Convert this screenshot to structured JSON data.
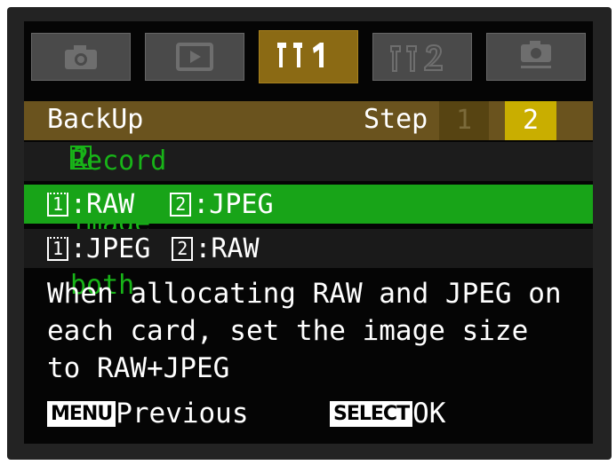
{
  "tabs": [
    {
      "label": "◉",
      "name": "shooting"
    },
    {
      "label": "▷",
      "name": "playback"
    },
    {
      "label": "ƒĂ1",
      "name": "setup-1"
    },
    {
      "label": "ƒĂ2",
      "name": "setup-2"
    },
    {
      "label": "▣",
      "name": "custom"
    }
  ],
  "header": {
    "title": "BackUp",
    "step_label": "Step",
    "step1": "1",
    "step2": "2"
  },
  "subtitle": "Record same image on both",
  "subtitle_slots": [
    "1",
    "2"
  ],
  "options": [
    {
      "slot1": "1",
      "val1": ":RAW",
      "slot2": "2",
      "val2": ":JPEG"
    },
    {
      "slot1": "1",
      "val1": ":JPEG",
      "slot2": "2",
      "val2": ":RAW"
    }
  ],
  "description": [
    "When allocating RAW and JPEG on",
    "each card, set the image size",
    "to RAW+JPEG"
  ],
  "footer": {
    "menu_key": "MENU",
    "menu_label": "Previous",
    "select_key": "SELECT",
    "select_label": "OK"
  },
  "colors": {
    "active_tab": "#8b6a14",
    "header": "#6a531e",
    "selected_row": "#18a418",
    "subtitle_text": "#18b418",
    "step_active": "#c9ae00"
  },
  "selected_option_index": 0,
  "active_tab": "setup-1"
}
